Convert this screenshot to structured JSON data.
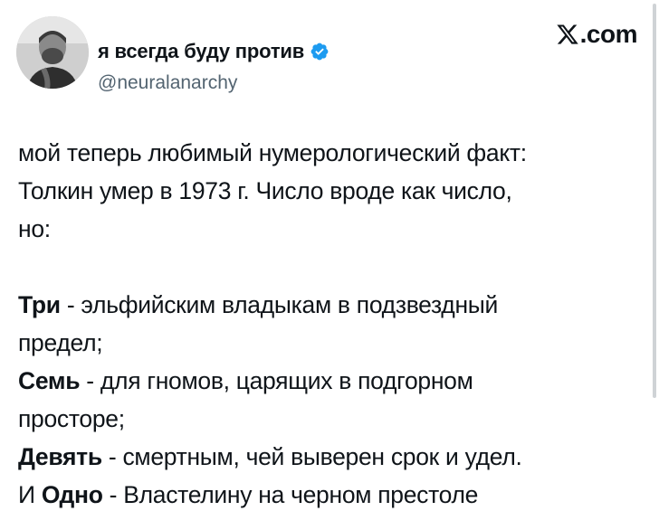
{
  "author": {
    "display_name": "я всегда буду против",
    "handle": "@neuralanarchy",
    "verified_icon": "verified-badge-icon",
    "avatar_icon": "avatar-photo"
  },
  "brand": {
    "label": ".com",
    "icon": "x-logo-icon"
  },
  "tweet": {
    "line1": "мой теперь любимый нумерологический факт:",
    "line2": "Толкин умер в 1973 г. Число вроде как число,",
    "line3": "но:",
    "l5_bold": "Три",
    "l5_rest": " - эльфийским владыкам в подзвездный",
    "line6": "предел;",
    "l7_bold": "Семь",
    "l7_rest": " - для гномов, царящих в подгорном",
    "line8": "просторе;",
    "l9_bold": "Девять",
    "l9_rest": " - смертным, чей выверен срок и удел.",
    "l10_pre": "И ",
    "l10_bold": "Одно",
    "l10_rest": " - Властелину на черном престоле"
  },
  "colors": {
    "verified": "#1d9bf0",
    "handle": "#536471",
    "text": "#0f1419"
  }
}
